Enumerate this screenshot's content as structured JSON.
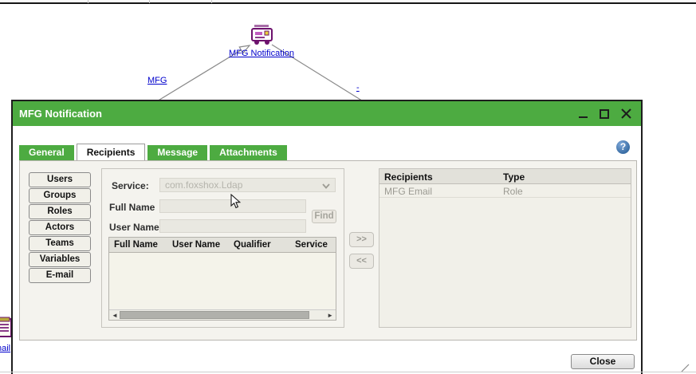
{
  "colors": {
    "accent_green": "#4dab41",
    "link_blue": "#0000cc",
    "help_blue": "#3a6ea5"
  },
  "diagram": {
    "node_label": "MFG Notification",
    "edge_label": "MFG",
    "edge2_label": "-",
    "clipped_node_label": "nail"
  },
  "dialog": {
    "title": "MFG Notification",
    "help_icon": "?",
    "tabs": [
      {
        "label": "General"
      },
      {
        "label": "Recipients"
      },
      {
        "label": "Message"
      },
      {
        "label": "Attachments"
      }
    ],
    "sidebar": {
      "buttons": [
        "Users",
        "Groups",
        "Roles",
        "Actors",
        "Teams",
        "Variables",
        "E-mail"
      ]
    },
    "form": {
      "service_label": "Service:",
      "service_value": "com.foxshox.Ldap",
      "full_name_label": "Full Name",
      "full_name_value": "",
      "user_name_label": "User Name",
      "user_name_value": "",
      "find_label": "Find"
    },
    "results_table": {
      "headers": [
        "Full Name",
        "User Name",
        "Qualifier",
        "Service"
      ]
    },
    "scrollbar": {
      "left_arrow": "◄",
      "right_arrow": "►"
    },
    "transfer": {
      "add_label": ">>",
      "remove_label": "<<"
    },
    "recipients": {
      "headers": [
        "Recipients",
        "Type"
      ],
      "rows": [
        {
          "name": "MFG Email",
          "type": "Role"
        }
      ]
    },
    "close_label": "Close"
  }
}
